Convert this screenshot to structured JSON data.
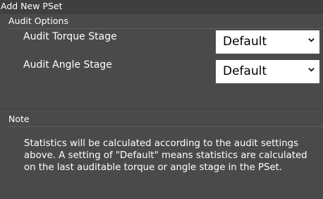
{
  "panel": {
    "title": "Add New PSet"
  },
  "audit_options": {
    "header": "Audit Options",
    "fields": [
      {
        "label": "Audit Torque Stage",
        "value": "Default"
      },
      {
        "label": "Audit Angle Stage",
        "value": "Default"
      }
    ]
  },
  "note": {
    "header": "Note",
    "text": "Statistics will be calculated according to the audit settings above. A setting of \"Default\" means statistics are calculated on the last auditable torque or angle stage in the PSet."
  },
  "icons": {
    "dropdown": "chevron-down-icon"
  }
}
